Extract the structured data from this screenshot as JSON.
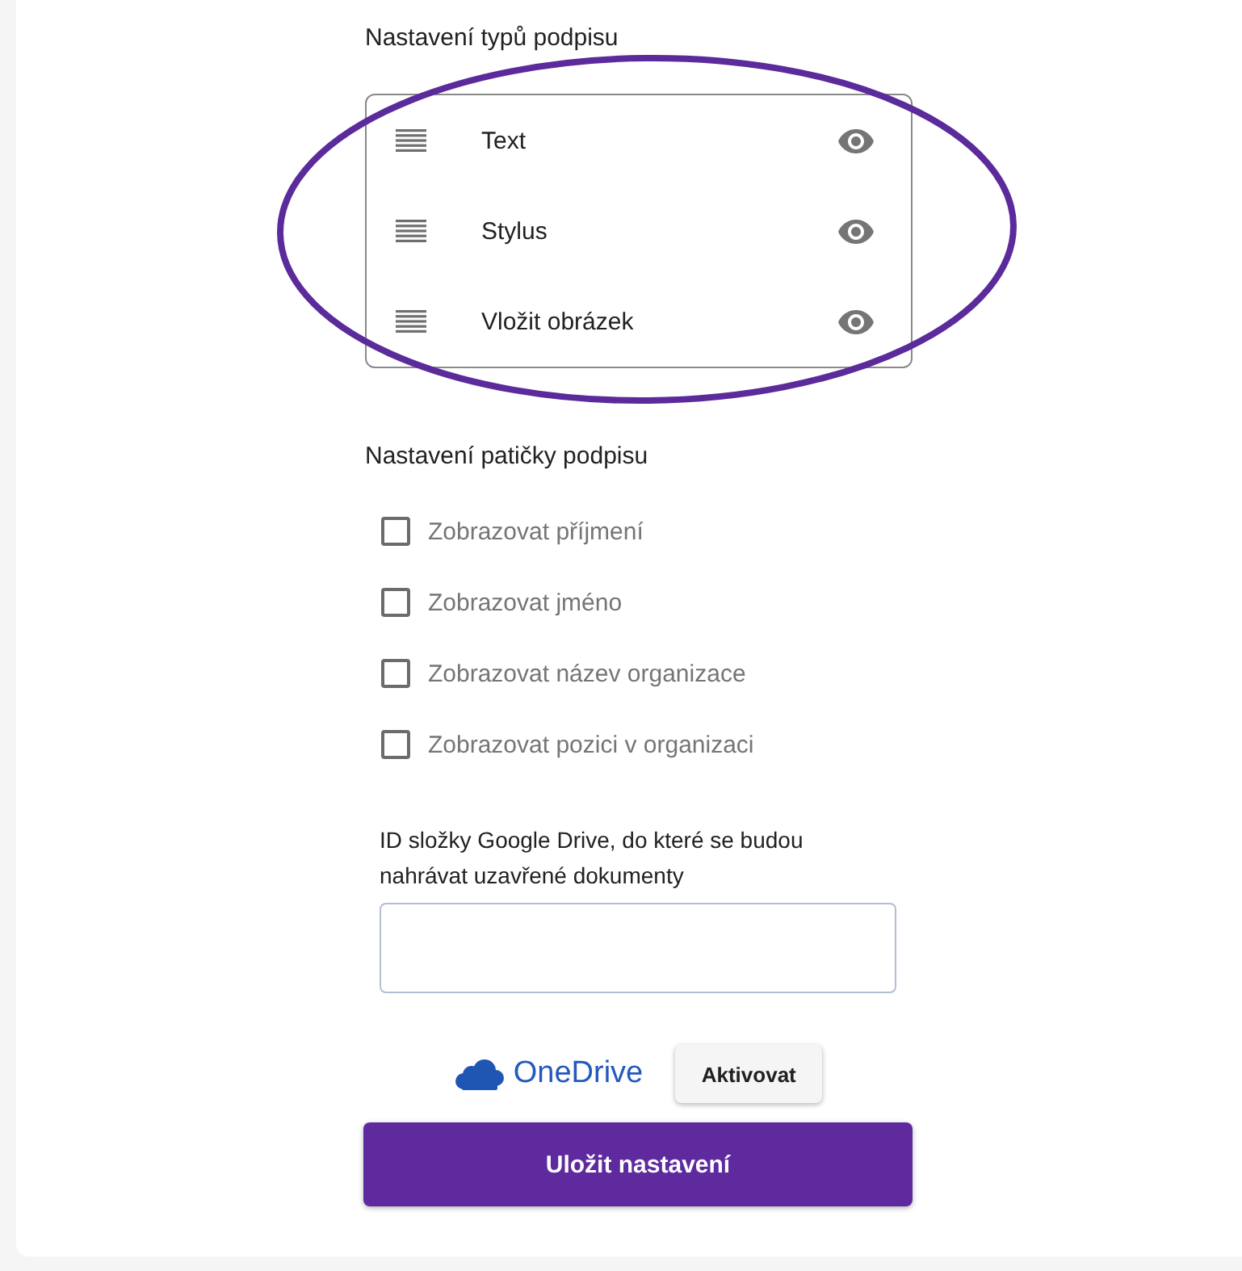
{
  "signature_types": {
    "heading": "Nastavení typů podpisu",
    "items": [
      {
        "label": "Text",
        "visible": true
      },
      {
        "label": "Stylus",
        "visible": true
      },
      {
        "label": "Vložit obrázek",
        "visible": true
      }
    ]
  },
  "annotation": {
    "kind": "ellipse"
  },
  "footer_settings": {
    "heading": "Nastavení patičky podpisu",
    "options": [
      {
        "label": "Zobrazovat příjmení",
        "checked": false
      },
      {
        "label": "Zobrazovat jméno",
        "checked": false
      },
      {
        "label": "Zobrazovat název organizace",
        "checked": false
      },
      {
        "label": "Zobrazovat pozici v organizaci",
        "checked": false
      }
    ]
  },
  "drive_folder": {
    "label": "ID složky Google Drive, do které se budou nahrávat uzavřené dokumenty"
  },
  "onedrive": {
    "logo_text": "OneDrive",
    "button": "Aktivovat"
  },
  "save_button": "Uložit nastavení"
}
